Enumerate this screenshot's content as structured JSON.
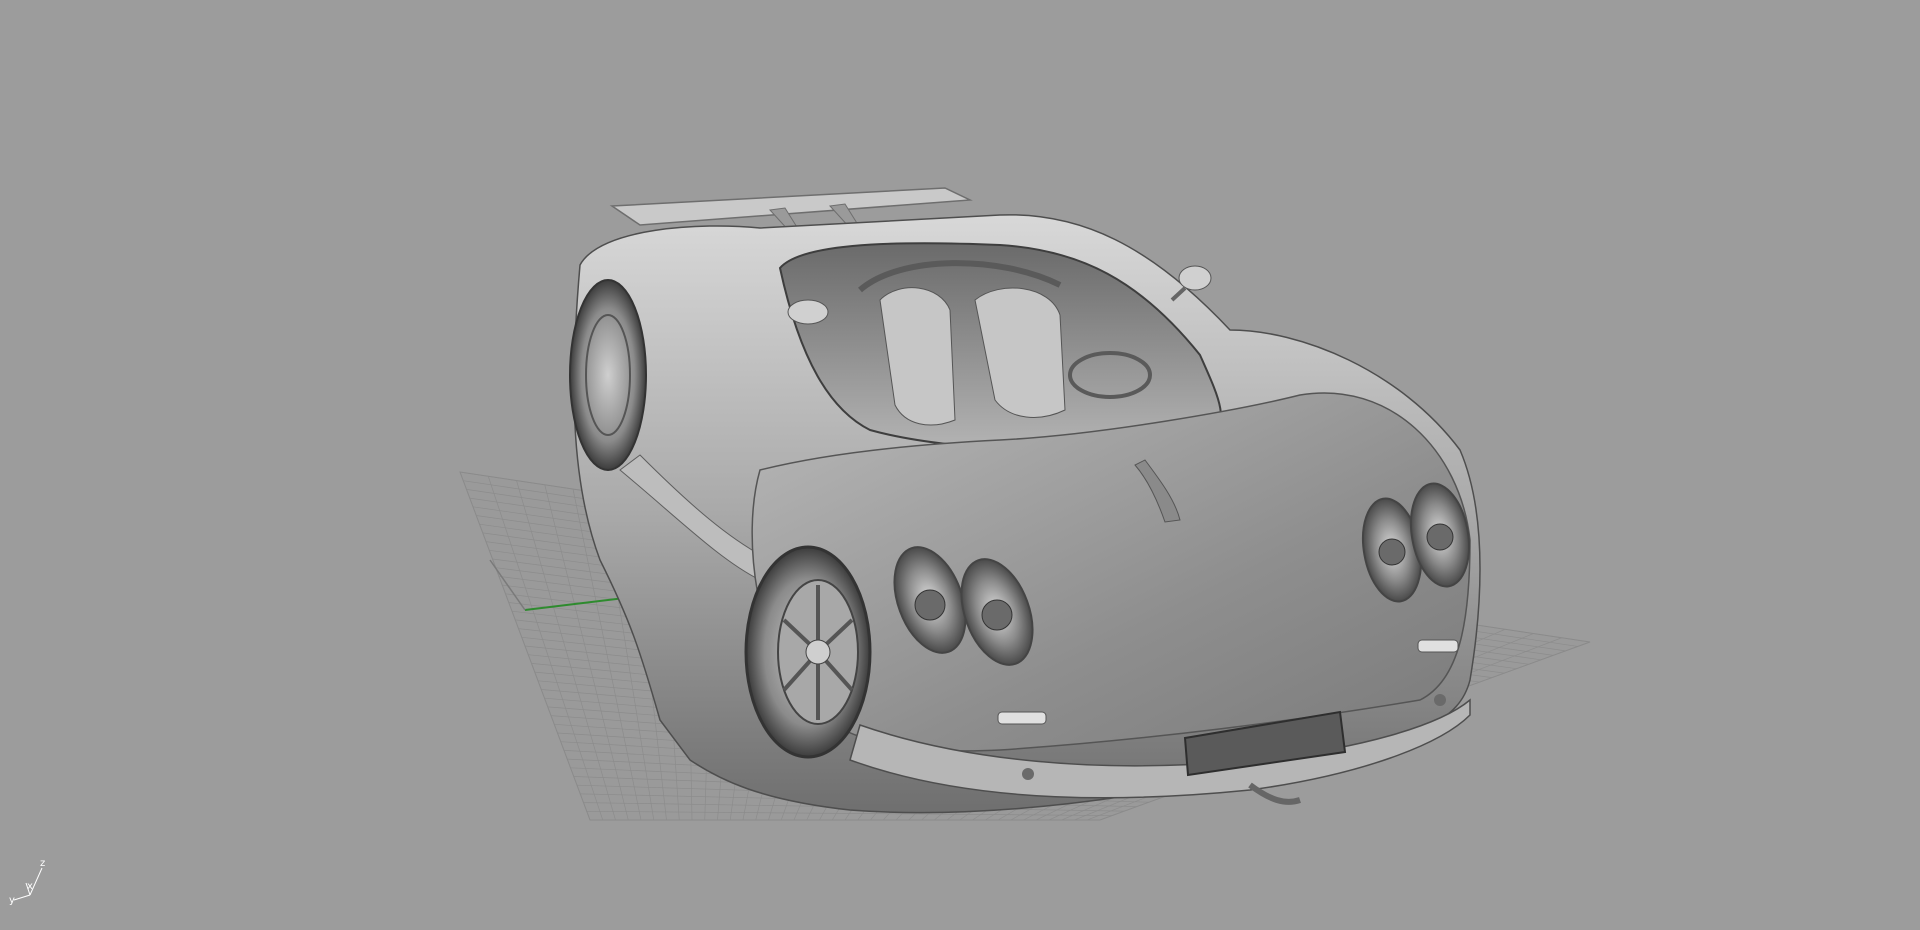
{
  "viewport": {
    "background": "#9c9c9c",
    "display_mode": "shaded",
    "object": "sports-car-model"
  },
  "grid": {
    "line_color": "#8a8a8a",
    "x_axis_color": "#2e8b2e",
    "y_axis_color": "#6b6b6b"
  },
  "axes_widget": {
    "labels": {
      "x": "x",
      "y": "y",
      "z": "z"
    },
    "color": "#ffffff"
  }
}
